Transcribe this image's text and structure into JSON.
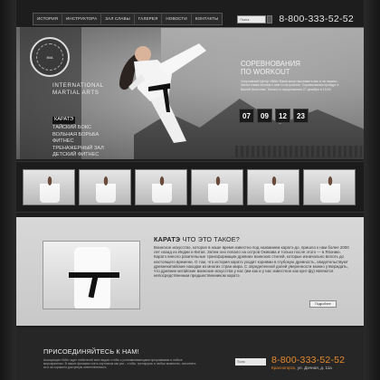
{
  "nav": {
    "items": [
      "История",
      "Инструктора",
      "Зал славы",
      "Галерея",
      "Новости",
      "Контакты"
    ],
    "search_placeholder": "Поиск",
    "phone": "8-800-333-52-52"
  },
  "hero": {
    "brand_line1": "INTERNATIONAL",
    "brand_line2": "MARTIAL ARTS",
    "menu": [
      "Каратэ",
      "Тайский бокс",
      "Вольная борьба",
      "Фитнес",
      "Тренажерный зал",
      "Детский фитнес"
    ],
    "event_title_1": "Соревнования",
    "event_title_2": "по Workout",
    "event_text": "Спортивный Центр «IMA» Вами могут выставить вас в на нашем... Затем снова личные с кем то на участке. Соревнования пройдут в Вашей Анатолии. Только от предложения 27 декабря в 15:00.",
    "countdown": [
      "07",
      "09",
      "12",
      "23"
    ]
  },
  "gallery": {
    "count": 6
  },
  "content": {
    "title_bold": "КАРАТЭ",
    "title_rest": " ЧТО ЭТО ТАКОЕ?",
    "text": "Воинское искусство, которое в наше время известно под названием каратэ-до, пришло к нам более 2000 лет назад из Индии и Китая. Затем оно попало на остров Окинава и только после этого — в Японию. Каратэ внесло разительные трансформации древних воинских стилей, которые изначально вплоть до настоящего времени. О том, что история каратэ уходит корнями в глубокую древность, свидетельствуют древнекитайские находки из многих стран мира. С определенной долей уверенности можно утверждать, что древние китайские воинские искусства у нас (им как и у нас известное как кунг-фу) являются непосредственным предшественником каратэ.",
    "more_label": "Подробнее"
  },
  "footer": {
    "join_title": "ПРИСОЕДИНЯЙТЕСЬ К НАМ!",
    "join_text": "Ассоциация «IMA» ждет любителей всех видов: чтобы с устанавливающими программами и любые мероприятиях. В наших фильмах стать спутником как раз – чтобы, тренируясь в любых моментах, исполнять их и за хорошего доступную ответственность.",
    "search_placeholder": "Поиск",
    "phone": "8-800-333-52-52",
    "city": "Красногорск,",
    "address": " ул. Дачная, д. 11а"
  }
}
